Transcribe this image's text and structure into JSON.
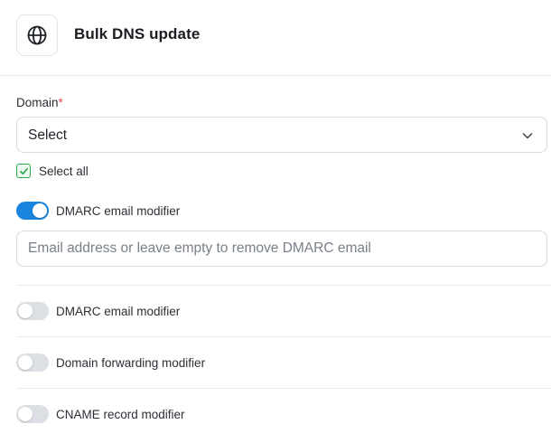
{
  "header": {
    "title": "Bulk DNS update",
    "icon": "globe-icon"
  },
  "domain_field": {
    "label": "Domain",
    "required_marker": "*",
    "selected_value": "Select"
  },
  "select_all": {
    "label": "Select all",
    "checked": true
  },
  "modifiers": [
    {
      "label": "DMARC email modifier",
      "enabled": true
    },
    {
      "label": "DMARC email modifier",
      "enabled": false
    },
    {
      "label": "Domain forwarding modifier",
      "enabled": false
    },
    {
      "label": "CNAME record modifier",
      "enabled": false
    }
  ],
  "dmarc_email_input": {
    "value": "",
    "placeholder": "Email address or leave empty to remove DMARC email"
  },
  "colors": {
    "toggle_on": "#1b84dc",
    "toggle_off": "#dcdfe3",
    "checkbox_accent": "#2ea64a",
    "required": "#e5484d"
  }
}
